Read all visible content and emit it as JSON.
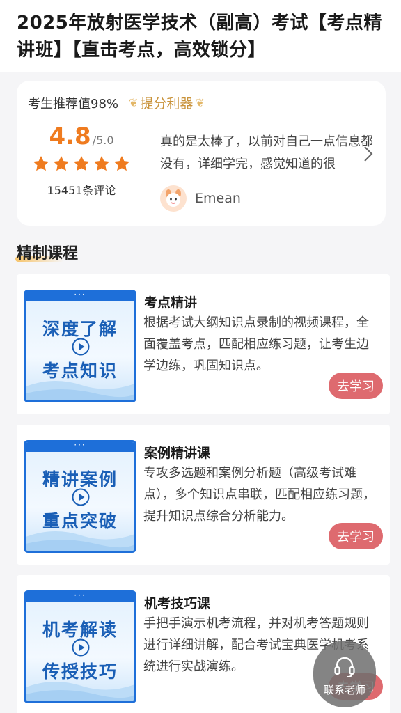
{
  "page": {
    "title": "2025年放射医学技术（副高）考试【考点精讲班】【直击考点，高效锁分】"
  },
  "summary": {
    "recommend_text": "考生推荐值98%",
    "badge_label": "提分利器",
    "score": "4.8",
    "score_max": "/5.0",
    "stars": 5,
    "review_count_text": "15451条评论",
    "review_text": "真的是太棒了，以前对自己一点信息都没有，详细学完，感觉知道的很",
    "reviewer_name": "Emean",
    "star_color": "#ef7b1f"
  },
  "section": {
    "title": "精制课程"
  },
  "courses": [
    {
      "thumb_line1": "深度了解",
      "thumb_line2": "考点知识",
      "title": "考点精讲",
      "desc": "根据考试大纲知识点录制的视频课程，全面覆盖考点，匹配相应练习题，让考生边学边练，巩固知识点。",
      "button": "去学习"
    },
    {
      "thumb_line1": "精讲案例",
      "thumb_line2": "重点突破",
      "title": "案例精讲课",
      "desc": "专攻多选题和案例分析题（高级考试难点），多个知识点串联，匹配相应练习题，提升知识点综合分析能力。",
      "button": "去学习"
    },
    {
      "thumb_line1": "机考解读",
      "thumb_line2": "传授技巧",
      "title": "机考技巧课",
      "desc": "手把手演示机考流程，并对机考答题规则进行详细讲解，配合考试宝典医学机考系统进行实战演练。",
      "button": "去学习"
    }
  ],
  "floating": {
    "contact_label": "联系老师"
  },
  "colors": {
    "accent_orange": "#ef7b1f",
    "button_red": "#de6a6f",
    "thumb_blue": "#1e6fd9"
  }
}
